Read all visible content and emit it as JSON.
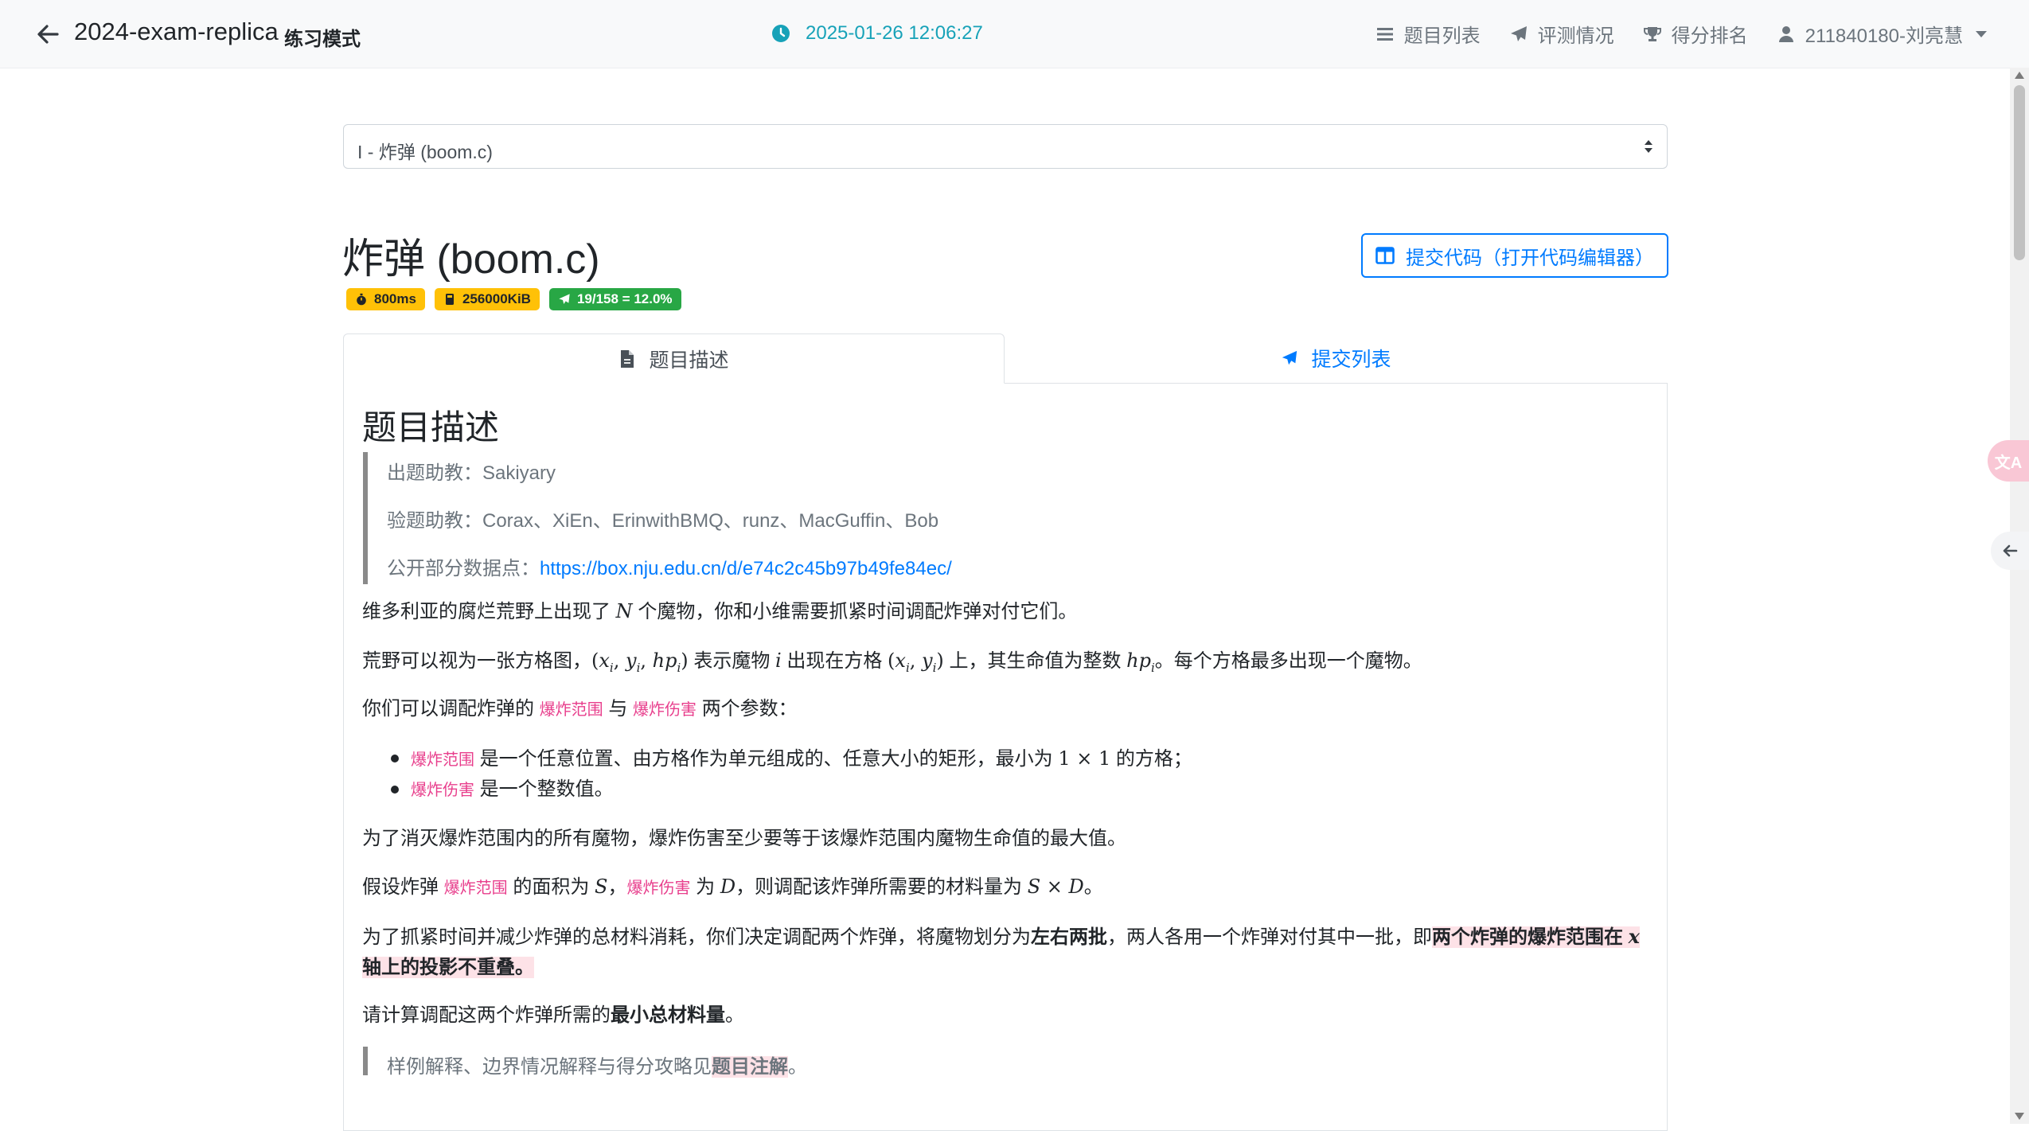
{
  "navbar": {
    "title": "2024-exam-replica",
    "mode": "练习模式",
    "clock": "2025-01-26 12:06:27",
    "nav_problem_list": "题目列表",
    "nav_judge_status": "评测情况",
    "nav_ranking": "得分排名",
    "nav_user": "211840180-刘亮慧"
  },
  "select": {
    "value": "I - 炸弹 (boom.c)"
  },
  "problem": {
    "title": "炸弹 (boom.c)",
    "time_limit": "800ms",
    "memory_limit": "256000KiB",
    "acceptance": "19/158 = 12.0%",
    "submit_button": "提交代码（打开代码编辑器）"
  },
  "tabs": {
    "description": "题目描述",
    "submissions": "提交列表"
  },
  "content": {
    "heading": "题目描述",
    "setter_line": "出题助教：Sakiyary",
    "tester_line": "验题助教：Corax、XiEn、ErinwithBMQ、runz、MacGuffin、Bob",
    "data_prefix": "公开部分数据点：",
    "data_url": "https://box.nju.edu.cn/d/e74c2c45b97b49fe84ec/",
    "p1_a": "维多利亚的腐烂荒野上出现了",
    "p1_n": "N",
    "p1_b": "个魔物，你和小维需要抓紧时间调配炸弹对付它们。",
    "p2_a": "荒野可以视为一张方格图，",
    "p2_tuple": "(x",
    "p2_b": "表示魔物",
    "p2_i": "i",
    "p2_c": "出现在方格",
    "p2_d": "上，其生命值为整数",
    "p2_e": "。每个方格最多出现一个魔物。",
    "p3_a": "你们可以调配炸弹的",
    "term_range": "爆炸范围",
    "p3_with": "与",
    "term_damage": "爆炸伤害",
    "p3_b": "两个参数：",
    "li1_text": "是一个任意位置、由方格作为单元组成的、任意大小的矩形，最小为",
    "li1_math": "1 × 1",
    "li1_end": "的方格；",
    "li2_text": "是一个整数值。",
    "p4": "为了消灭爆炸范围内的所有魔物，爆炸伤害至少要等于该爆炸范围内魔物生命值的最大值。",
    "p5_a": "假设炸弹",
    "p5_b": "的面积为",
    "p5_s": "S",
    "p5_c": "，",
    "p5_d": "为",
    "p5_dd": "D",
    "p5_e": "，则调配该炸弹所需要的材料量为",
    "p5_f": "S × D",
    "p5_g": "。",
    "p6_a": "为了抓紧时间并减少炸弹的总材料消耗，你们决定调配两个炸弹，将魔物划分为",
    "p6_bold1": "左右两批",
    "p6_b": "，两人各用一个炸弹对付其中一批，即",
    "p6_mark": "两个炸弹的爆炸范围在",
    "p6_x": "x",
    "p6_mark2": "轴上的投影不重叠。",
    "p7_a": "请计算调配这两个炸弹所需的",
    "p7_bold": "最小总材料量",
    "p7_b": "。",
    "note_a": "样例解释、边界情况解释与得分攻略见",
    "note_mark": "题目注解",
    "note_b": "。"
  },
  "colors": {
    "accent": "#007bff",
    "info": "#17a2b8",
    "warning": "#ffc107",
    "success": "#28a745",
    "term": "#e83e8c",
    "highlight": "#fde2e7"
  },
  "icons": [
    "arrow-left-icon",
    "clock-icon",
    "list-icon",
    "paper-plane-icon",
    "trophy-icon",
    "user-icon",
    "stopwatch-icon",
    "memory-icon",
    "columns-icon",
    "file-icon",
    "translate-icon"
  ]
}
